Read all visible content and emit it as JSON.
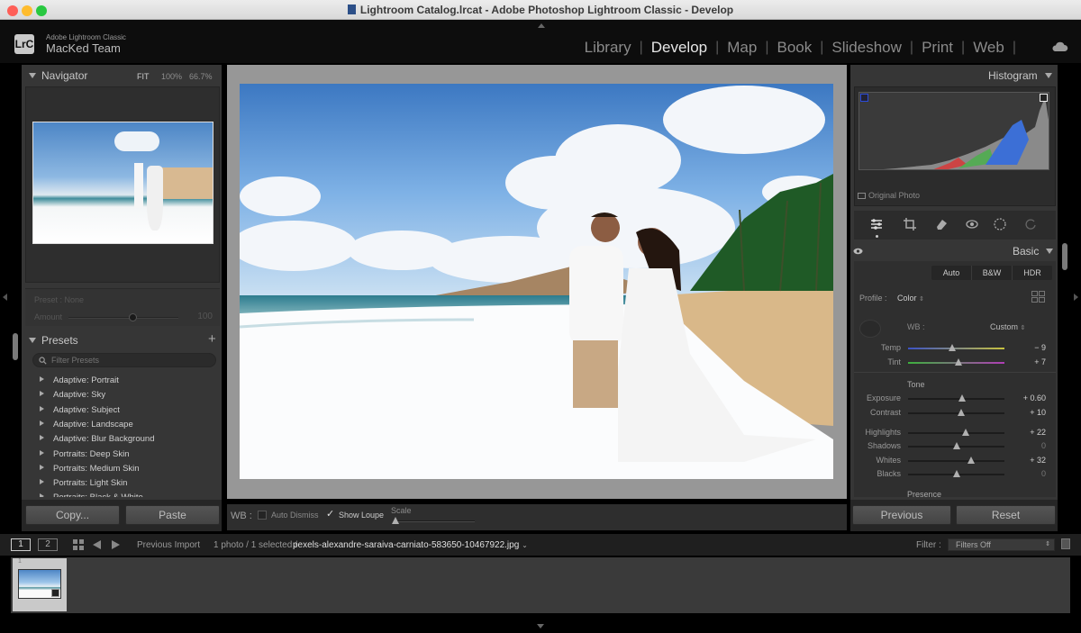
{
  "window": {
    "title": "Lightroom Catalog.lrcat - Adobe Photoshop Lightroom Classic - Develop"
  },
  "brand": {
    "logo": "LrC",
    "app": "Adobe Lightroom Classic",
    "user": "MacKed Team"
  },
  "modules": [
    "Library",
    "Develop",
    "Map",
    "Book",
    "Slideshow",
    "Print",
    "Web"
  ],
  "navigator": {
    "title": "Navigator",
    "fit": "FIT",
    "z100": "100%",
    "zoom": "66.7%"
  },
  "preset_amount": {
    "preset_label": "Preset : None",
    "amount_label": "Amount",
    "amount_value": "100",
    "amount_fraction": 0.58
  },
  "presets": {
    "title": "Presets",
    "add": "+",
    "search_placeholder": "Filter Presets",
    "items": [
      "Adaptive: Portrait",
      "Adaptive: Sky",
      "Adaptive: Subject",
      "Adaptive: Landscape",
      "Adaptive: Blur Background",
      "Portraits: Deep Skin",
      "Portraits: Medium Skin",
      "Portraits: Light Skin",
      "Portraits: Black & White"
    ]
  },
  "left_buttons": {
    "copy": "Copy...",
    "paste": "Paste"
  },
  "toolbar": {
    "wb": "WB :",
    "auto_dismiss": "Auto Dismiss",
    "show_loupe": "Show Loupe",
    "show_loupe_checked": true,
    "scale": "Scale"
  },
  "histogram": {
    "title": "Histogram",
    "original_photo": "Original Photo"
  },
  "basic": {
    "title": "Basic",
    "auto": "Auto",
    "bw": "B&W",
    "hdr": "HDR",
    "profile_label": "Profile :",
    "profile_value": "Color",
    "wb_label": "WB :",
    "wb_value": "Custom",
    "tone_label": "Tone",
    "presence_label": "Presence",
    "sliders": [
      {
        "label": "Temp",
        "value": "− 9",
        "pos": 0.46,
        "kind": "temp"
      },
      {
        "label": "Tint",
        "value": "+ 7",
        "pos": 0.52,
        "kind": "tint"
      },
      {
        "label": "Exposure",
        "value": "+ 0.60",
        "pos": 0.56,
        "kind": "tone"
      },
      {
        "label": "Contrast",
        "value": "+ 10",
        "pos": 0.55,
        "kind": "tone"
      },
      {
        "label": "Highlights",
        "value": "+ 22",
        "pos": 0.6,
        "kind": "tone"
      },
      {
        "label": "Shadows",
        "value": "0",
        "pos": 0.5,
        "kind": "tone"
      },
      {
        "label": "Whites",
        "value": "+ 32",
        "pos": 0.65,
        "kind": "tone"
      },
      {
        "label": "Blacks",
        "value": "0",
        "pos": 0.5,
        "kind": "tone"
      }
    ]
  },
  "right_buttons": {
    "previous": "Previous",
    "reset": "Reset"
  },
  "filmbar": {
    "view1": "1",
    "view2": "2",
    "source": "Previous Import",
    "count": "1 photo / 1 selected /",
    "filename": "pexels-alexandre-saraiva-carniato-583650-10467922.jpg",
    "filter_label": "Filter :",
    "filter_value": "Filters Off",
    "thumb_index": "1"
  },
  "colors": {
    "accent": "#e6e6e6",
    "panel": "#363636",
    "bg": "#000000"
  }
}
